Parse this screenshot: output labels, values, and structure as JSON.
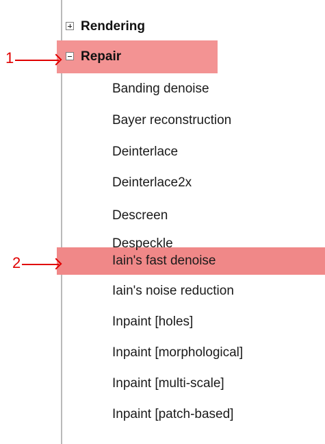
{
  "tree": {
    "nodes": [
      {
        "label": "Rendering",
        "type": "category",
        "expanded": false,
        "expander_icon": "plus-box-icon"
      },
      {
        "label": "Repair",
        "type": "category",
        "expanded": true,
        "expander_icon": "minus-box-icon"
      },
      {
        "label": "Banding denoise",
        "type": "filter"
      },
      {
        "label": "Bayer reconstruction",
        "type": "filter"
      },
      {
        "label": "Deinterlace",
        "type": "filter"
      },
      {
        "label": "Deinterlace2x",
        "type": "filter"
      },
      {
        "label": "Descreen",
        "type": "filter"
      },
      {
        "label": "Despeckle",
        "type": "filter"
      },
      {
        "label": "Iain's fast denoise",
        "type": "filter"
      },
      {
        "label": "Iain's noise reduction",
        "type": "filter"
      },
      {
        "label": "Inpaint [holes]",
        "type": "filter"
      },
      {
        "label": "Inpaint [morphological]",
        "type": "filter"
      },
      {
        "label": "Inpaint [multi-scale]",
        "type": "filter"
      },
      {
        "label": "Inpaint [patch-based]",
        "type": "filter"
      }
    ]
  },
  "annotations": {
    "marker_1": {
      "label": "1",
      "color": "#e00000",
      "highlight_color": "#f39393",
      "icon": "right-arrow-icon"
    },
    "marker_2": {
      "label": "2",
      "color": "#e00000",
      "highlight_color": "#f08888",
      "icon": "right-arrow-icon"
    }
  }
}
